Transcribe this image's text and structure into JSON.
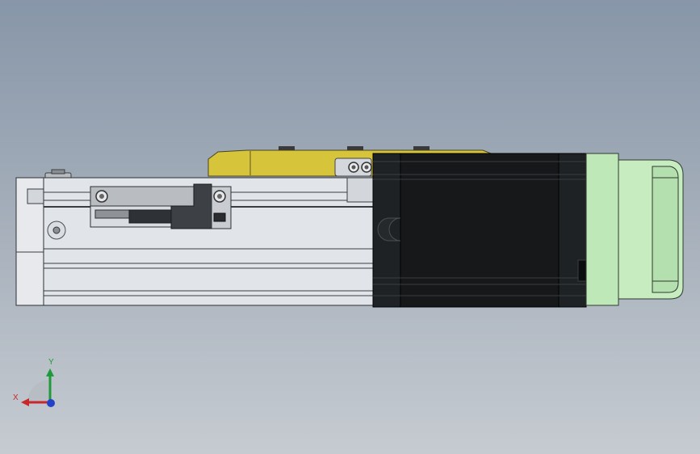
{
  "viewport": {
    "background_top": "#8796a8",
    "background_bottom": "#c6cbd1"
  },
  "model": {
    "parts": [
      "linear-actuator-body",
      "carriage",
      "yellow-bracket",
      "stepper-motor",
      "motor-end-cap"
    ],
    "colors": {
      "rail": "#dfe2e6",
      "rail_edge": "#3a3f45",
      "bracket": "#d6c43a",
      "motor": "#16181a",
      "end_cap": "#bfe8b9",
      "carriage": "#b9bcc0"
    }
  },
  "triad": {
    "x_label": "X",
    "y_label": "Y",
    "colors": {
      "x": "#c8272b",
      "y": "#1f9a3b",
      "z": "#2342c8"
    }
  }
}
